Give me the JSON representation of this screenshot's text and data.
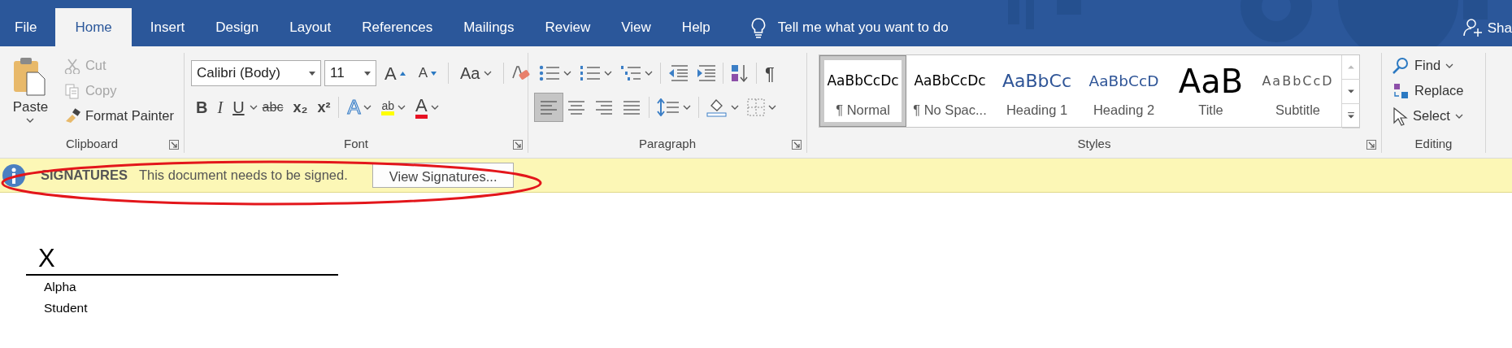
{
  "tabs": [
    {
      "label": "File",
      "selected": false
    },
    {
      "label": "Home",
      "selected": true
    },
    {
      "label": "Insert",
      "selected": false
    },
    {
      "label": "Design",
      "selected": false
    },
    {
      "label": "Layout",
      "selected": false
    },
    {
      "label": "References",
      "selected": false
    },
    {
      "label": "Mailings",
      "selected": false
    },
    {
      "label": "Review",
      "selected": false
    },
    {
      "label": "View",
      "selected": false
    },
    {
      "label": "Help",
      "selected": false
    }
  ],
  "tell_me": "Tell me what you want to do",
  "account": "Sha",
  "clipboard": {
    "label": "Clipboard",
    "paste": "Paste",
    "items": [
      {
        "label": "Cut",
        "kind": "cut",
        "disabled": true
      },
      {
        "label": "Copy",
        "kind": "copy",
        "disabled": true
      },
      {
        "label": "Format Painter",
        "kind": "painter",
        "disabled": false
      }
    ]
  },
  "font": {
    "label": "Font",
    "font_name": "Calibri (Body)",
    "font_size": "11",
    "row1": [
      {
        "kind": "grow",
        "glyph": "A"
      },
      {
        "kind": "shrink",
        "glyph": "A"
      },
      {
        "kind": "case",
        "glyph": "Aa"
      }
    ],
    "row2": [
      {
        "kind": "bold",
        "glyph": "B"
      },
      {
        "kind": "italic",
        "glyph": "I"
      },
      {
        "kind": "underline",
        "glyph": "U"
      },
      {
        "kind": "strike",
        "glyph": "abc"
      },
      {
        "kind": "sub",
        "glyph": "x₂"
      },
      {
        "kind": "sup",
        "glyph": "x²"
      }
    ],
    "effects": [
      {
        "kind": "text_effects",
        "glyph": "A"
      },
      {
        "kind": "highlight",
        "glyph": "ab",
        "color": "#ffff00"
      },
      {
        "kind": "font_color",
        "glyph": "A",
        "color": "#e81123"
      }
    ]
  },
  "paragraph": {
    "label": "Paragraph",
    "pilcrow": "¶",
    "alignments": [
      {
        "kind": "left",
        "selected": true
      },
      {
        "kind": "center",
        "selected": false
      },
      {
        "kind": "right",
        "selected": false
      },
      {
        "kind": "justify",
        "selected": false
      }
    ]
  },
  "styles": {
    "label": "Styles",
    "items": [
      {
        "kind": "normal",
        "preview": "AaBbCcDc",
        "label": "¶ Normal",
        "selected": true
      },
      {
        "kind": "no_spacing",
        "preview": "AaBbCcDc",
        "label": "¶ No Spac...",
        "selected": false
      },
      {
        "kind": "heading1",
        "preview": "AaBbCc",
        "label": "Heading 1",
        "selected": false
      },
      {
        "kind": "heading2",
        "preview": "AaBbCcD",
        "label": "Heading 2",
        "selected": false
      },
      {
        "kind": "title",
        "preview": "AaB",
        "label": "Title",
        "selected": false
      },
      {
        "kind": "subtitle",
        "preview": "AaBbCcD",
        "label": "Subtitle",
        "selected": false
      }
    ]
  },
  "editing": {
    "label": "Editing",
    "items": [
      {
        "kind": "find",
        "label": "Find"
      },
      {
        "kind": "replace",
        "label": "Replace"
      },
      {
        "kind": "select",
        "label": "Select"
      }
    ]
  },
  "message_bar": {
    "title": "SIGNATURES",
    "message": "This document needs to be signed.",
    "button": "View Signatures..."
  },
  "document": {
    "mark": "X",
    "signer_name": "Alpha",
    "signer_title": "Student"
  }
}
